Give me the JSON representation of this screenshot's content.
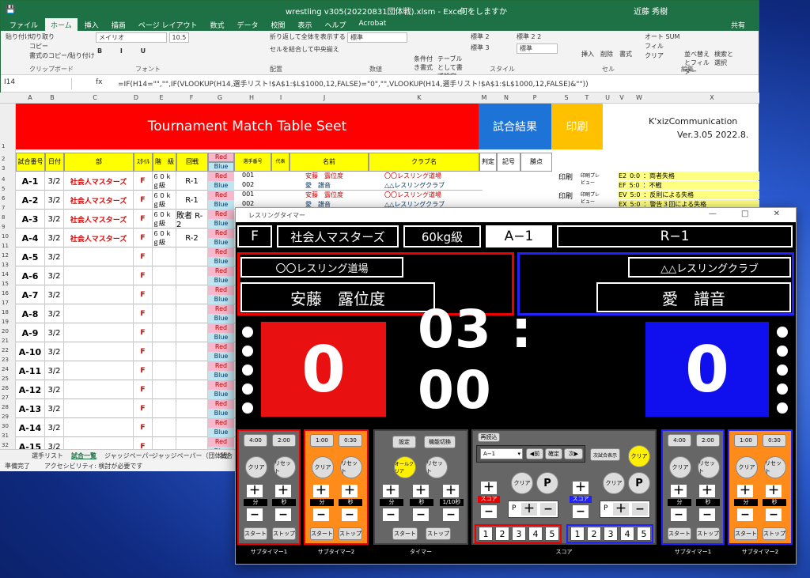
{
  "excel": {
    "title": "wrestling v305(20220831団体戦).xlsm - Excel",
    "search": "何をしますか",
    "user": "近藤 秀樹",
    "share": "共有",
    "menu": [
      "ファイル",
      "ホーム",
      "挿入",
      "描画",
      "ページ レイアウト",
      "数式",
      "データ",
      "校閲",
      "表示",
      "ヘルプ",
      "Acrobat"
    ],
    "ribbon": {
      "paste": "貼り付け",
      "cut": "切り取り",
      "copy": "コピー",
      "fmtpaint": "書式のコピー/貼り付け",
      "clip": "クリップボード",
      "font": "メイリオ",
      "size": "10.5",
      "fontgrp": "フォント",
      "wrap": "折り返して全体を表示する",
      "merge": "セルを結合して中央揃え",
      "align": "配置",
      "numfmt": "標準",
      "numgrp": "数値",
      "cond": "条件付き書式",
      "table": "テーブルとして書式設定",
      "style1": "標準 2",
      "style2": "標準 2 2",
      "style3": "標準 3",
      "style4": "標準",
      "stylegrp": "スタイル",
      "insert": "挿入",
      "delete": "削除",
      "format": "書式",
      "cellgrp": "セル",
      "autosum": "オート SUM",
      "fill": "フィル",
      "clear": "クリア",
      "sort": "並べ替えとフィルター",
      "find": "検索と選択",
      "editgrp": "編集"
    },
    "namebox": "I14",
    "formula": "=IF(H14=\"\",\"\",IF(VLOOKUP(H14,選手リスト!$A$1:$L$1000,12,FALSE)=\"0\",\"\",VLOOKUP(H14,選手リスト!$A$1:$L$1000,12,FALSE)&\"\"))",
    "cols": [
      "A",
      "B",
      "C",
      "D",
      "E",
      "F",
      "G",
      "H",
      "I",
      "J",
      "K",
      "M",
      "N",
      "P",
      "S",
      "T",
      "U",
      "V",
      "W",
      "X"
    ],
    "rownums": [
      "1",
      "2",
      "3",
      "4",
      "5",
      "6",
      "7",
      "8",
      "9",
      "10",
      "11",
      "12",
      "13",
      "14",
      "15",
      "16",
      "17",
      "18",
      "19",
      "20",
      "21",
      "22",
      "23",
      "24",
      "25",
      "26",
      "27",
      "28",
      "29",
      "30",
      "31",
      "32",
      "33"
    ],
    "banner": "Tournament Match Table Seet",
    "results": "試合結果",
    "print": "印刷",
    "company": "K'xizCommunication",
    "version": "Ver.3.05 2022.8.",
    "headers": {
      "no": "試合番号",
      "date": "日付",
      "div": "部",
      "style": "ｽﾀｲﾙ",
      "weight": "階　級",
      "round": "回戦",
      "red": "Red",
      "blue": "Blue",
      "pno": "選手番号",
      "rep": "代表",
      "name": "名前",
      "club": "クラブ名",
      "judge": "判定",
      "mark": "記号",
      "pts": "勝点"
    },
    "matches": [
      {
        "id": "A-1",
        "date": "3/2",
        "div": "社会人マスターズ",
        "style": "F",
        "weight": "６０ｋｇ級",
        "round": "R-1"
      },
      {
        "id": "A-2",
        "date": "3/2",
        "div": "社会人マスターズ",
        "style": "F",
        "weight": "６０ｋｇ級",
        "round": "R-1"
      },
      {
        "id": "A-3",
        "date": "3/2",
        "div": "社会人マスターズ",
        "style": "F",
        "weight": "６０ｋｇ級",
        "round": "敗者 R-2"
      },
      {
        "id": "A-4",
        "date": "3/2",
        "div": "社会人マスターズ",
        "style": "F",
        "weight": "６０ｋｇ級",
        "round": "R-2"
      },
      {
        "id": "A-5",
        "date": "3/2",
        "div": "",
        "style": "F",
        "weight": "",
        "round": ""
      },
      {
        "id": "A-6",
        "date": "3/2",
        "div": "",
        "style": "F",
        "weight": "",
        "round": ""
      },
      {
        "id": "A-7",
        "date": "3/2",
        "div": "",
        "style": "F",
        "weight": "",
        "round": ""
      },
      {
        "id": "A-8",
        "date": "3/2",
        "div": "",
        "style": "F",
        "weight": "",
        "round": ""
      },
      {
        "id": "A-9",
        "date": "3/2",
        "div": "",
        "style": "F",
        "weight": "",
        "round": ""
      },
      {
        "id": "A-10",
        "date": "3/2",
        "div": "",
        "style": "F",
        "weight": "",
        "round": ""
      },
      {
        "id": "A-11",
        "date": "3/2",
        "div": "",
        "style": "F",
        "weight": "",
        "round": ""
      },
      {
        "id": "A-12",
        "date": "3/2",
        "div": "",
        "style": "F",
        "weight": "",
        "round": ""
      },
      {
        "id": "A-13",
        "date": "3/2",
        "div": "",
        "style": "F",
        "weight": "",
        "round": ""
      },
      {
        "id": "A-14",
        "date": "3/2",
        "div": "",
        "style": "F",
        "weight": "",
        "round": ""
      },
      {
        "id": "A-15",
        "date": "3/2",
        "div": "",
        "style": "F",
        "weight": "",
        "round": ""
      }
    ],
    "athletes": [
      {
        "no": "001",
        "name": "安藤　露位度",
        "club": "〇〇レスリング道場"
      },
      {
        "no": "002",
        "name": "愛　譜音",
        "club": "△△レスリングクラブ"
      },
      {
        "no": "001",
        "name": "安藤　露位度",
        "club": "〇〇レスリング道場"
      },
      {
        "no": "002",
        "name": "愛　譜音",
        "club": "△△レスリングクラブ"
      }
    ],
    "printbtn": "印刷",
    "preview": "印刷プレビュー",
    "codes": [
      {
        "c": "E2",
        "s": "0:0",
        "d": "：両者失格"
      },
      {
        "c": "EF",
        "s": "5:0",
        "d": "：不戦"
      },
      {
        "c": "EV",
        "s": "5:0",
        "d": "：反則による失格"
      },
      {
        "c": "EX",
        "s": "5:0",
        "d": "：警告３回による失格"
      }
    ],
    "sheets": [
      "選手リスト",
      "試合一覧",
      "ジャッジペーパー",
      "ジャッジペーパー（団体戦）",
      "試合"
    ],
    "status": "準備完了",
    "access": "アクセシビリティ: 検討が必要です"
  },
  "timer": {
    "wintitle": "レスリングタイマー",
    "style": "F",
    "division": "社会人マスターズ",
    "weight": "60kg級",
    "match": "A−1",
    "round": "R−1",
    "red_club": "〇〇レスリング道場",
    "red_name": "安藤　露位度",
    "blue_club": "△△レスリングクラブ",
    "blue_name": "愛　譜音",
    "red_score": "0",
    "blue_score": "0",
    "clock": "03 : 00",
    "btn": {
      "t400": "4:00",
      "t200": "2:00",
      "t100": "1:00",
      "t030": "0:30",
      "clear": "クリア",
      "reset": "リセット",
      "start": "スタート",
      "stop": "ストップ",
      "min": "分",
      "sec": "秒",
      "tenth": "1/10秒",
      "setting": "設定",
      "mode": "機能切換",
      "allclear": "オールクリア",
      "reload": "再読込",
      "select": "A−1",
      "prev": "前",
      "confirm": "確定",
      "next": "次",
      "nextshow": "次試合表示",
      "p": "P",
      "score": "スコア",
      "plus": "＋",
      "minus": "−"
    },
    "captions": [
      "サブタイマー1",
      "サブタイマー2",
      "タイマー",
      "スコア",
      "サブタイマー1",
      "サブタイマー2"
    ],
    "nums": [
      "1",
      "2",
      "3",
      "4",
      "5"
    ]
  },
  "colors": {
    "red": "#ff0000",
    "blue": "#1e73d6",
    "yellow": "#ffc000",
    "excel": "#1e7145"
  }
}
